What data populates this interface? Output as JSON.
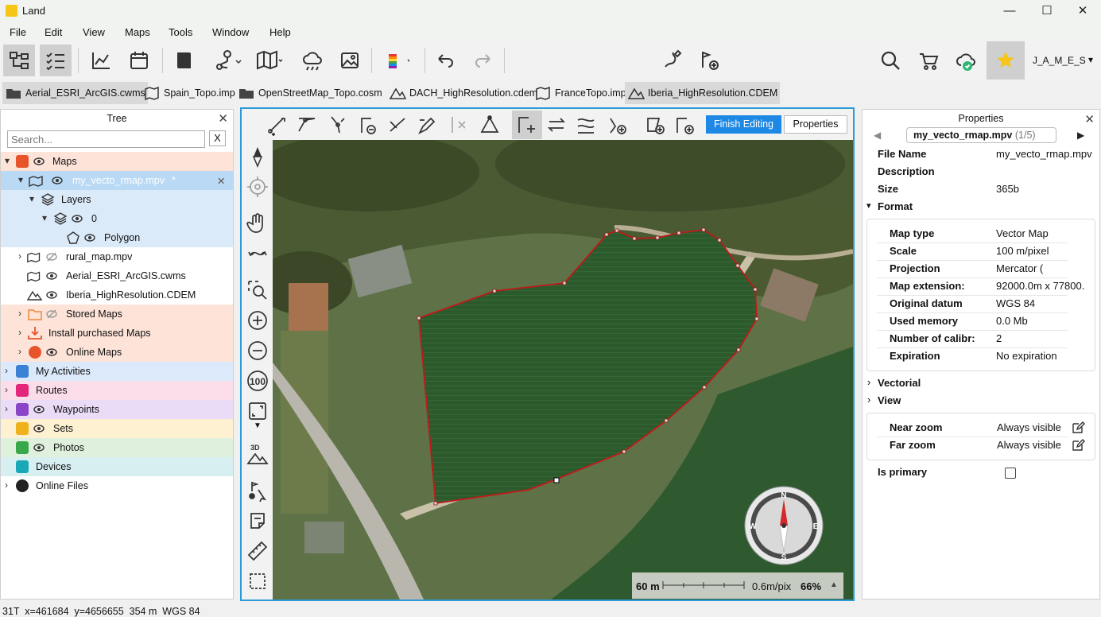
{
  "window": {
    "title": "Land",
    "minimize": "—",
    "maximize": "☐",
    "close": "✕"
  },
  "menu": [
    "File",
    "Edit",
    "View",
    "Maps",
    "Tools",
    "Window",
    "Help"
  ],
  "toolbar": {
    "user": "J_A_M_E_S",
    "user_caret": "▾"
  },
  "file_tabs": [
    {
      "label": "Aerial_ESRI_ArcGIS.cwms",
      "icon": "folder-icon"
    },
    {
      "label": "Spain_Topo.imp",
      "icon": "map-icon"
    },
    {
      "label": "OpenStreetMap_Topo.cosm",
      "icon": "folder-icon"
    },
    {
      "label": "DACH_HighResolution.cdem",
      "icon": "terrain-icon"
    },
    {
      "label": "FranceTopo.imp",
      "icon": "map-icon"
    },
    {
      "label": "Iberia_HighResolution.CDEM",
      "icon": "terrain-icon"
    }
  ],
  "tree": {
    "header": "Tree",
    "close": "✕",
    "search_placeholder": "Search...",
    "clear": "X",
    "items": [
      {
        "label": "Maps",
        "arrow": "▾",
        "color": "#e8542a",
        "bg": "#fde3d8"
      },
      {
        "label": "my_vecto_rmap.mpv",
        "suffix": "*",
        "close": "✕",
        "arrow": "▾",
        "bg": "#b9d9f5"
      },
      {
        "label": "Layers",
        "arrow": "▾",
        "bg": "#dbeaf9"
      },
      {
        "label": "0",
        "arrow": "▾",
        "bg": "#dbeaf9"
      },
      {
        "label": "Polygon",
        "bg": "#dbeaf9"
      },
      {
        "label": "rural_map.mpv",
        "arrow": "›",
        "bg": "#ffffff"
      },
      {
        "label": "Aerial_ESRI_ArcGIS.cwms",
        "bg": "#ffffff"
      },
      {
        "label": "Iberia_HighResolution.CDEM",
        "bg": "#ffffff"
      },
      {
        "label": "Stored Maps",
        "arrow": "›",
        "color": "#f0883a",
        "bg": "#fde3d8"
      },
      {
        "label": "Install purchased Maps",
        "arrow": "›",
        "color": "#e8542a",
        "bg": "#fde3d8"
      },
      {
        "label": "Online Maps",
        "arrow": "›",
        "color": "#e8542a",
        "bg": "#fde3d8"
      },
      {
        "label": "My Activities",
        "arrow": "›",
        "color": "#3b82d6",
        "bg": "#dbe9fb"
      },
      {
        "label": "Routes",
        "arrow": "›",
        "color": "#e3267a",
        "bg": "#fbdde9"
      },
      {
        "label": "Waypoints",
        "arrow": "›",
        "color": "#8a44c8",
        "bg": "#eadcf7"
      },
      {
        "label": "Sets",
        "color": "#f0b21a",
        "bg": "#fdf1d2"
      },
      {
        "label": "Photos",
        "color": "#39a84a",
        "bg": "#dff0dc"
      },
      {
        "label": "Devices",
        "color": "#1aa8b8",
        "bg": "#d7eff1"
      },
      {
        "label": "Online Files",
        "arrow": "›",
        "color": "#222222",
        "bg": "#ffffff"
      }
    ]
  },
  "editor": {
    "finish": "Finish Editing",
    "properties": "Properties"
  },
  "scale": {
    "distance": "60 m",
    "resolution": "0.6m/pix",
    "zoom": "66%",
    "caret": "▲"
  },
  "compass": {
    "n": "N",
    "s": "S",
    "e": "E",
    "w": "W"
  },
  "properties": {
    "header": "Properties",
    "close": "✕",
    "prev": "◀",
    "next": "▶",
    "file": "my_vecto_rmap.mpv",
    "count": "(1/5)",
    "fields": [
      {
        "label": "File Name",
        "value": "my_vecto_rmap.mpv"
      },
      {
        "label": "Description",
        "value": ""
      },
      {
        "label": "Size",
        "value": "365b"
      }
    ],
    "format_title": "Format",
    "format": [
      {
        "label": "Map type",
        "value": "Vector Map"
      },
      {
        "label": "Scale",
        "value": "100 m/pixel"
      },
      {
        "label": "Projection",
        "value": "Mercator ("
      },
      {
        "label": "Map extension:",
        "value": "92000.0m x 77800."
      },
      {
        "label": "Original datum",
        "value": "WGS 84"
      },
      {
        "label": "Used memory",
        "value": "0.0 Mb"
      },
      {
        "label": "Number of calibr:",
        "value": "2"
      },
      {
        "label": "Expiration",
        "value": "No expiration"
      }
    ],
    "vectorial_title": "Vectorial",
    "view_title": "View",
    "view": [
      {
        "label": "Near zoom",
        "value": "Always visible"
      },
      {
        "label": "Far zoom",
        "value": "Always visible"
      }
    ],
    "primary_label": "Is primary",
    "expand": "›",
    "collapse": "▾"
  },
  "status": "31T  x=461684  y=4656655  354 m  WGS 84"
}
